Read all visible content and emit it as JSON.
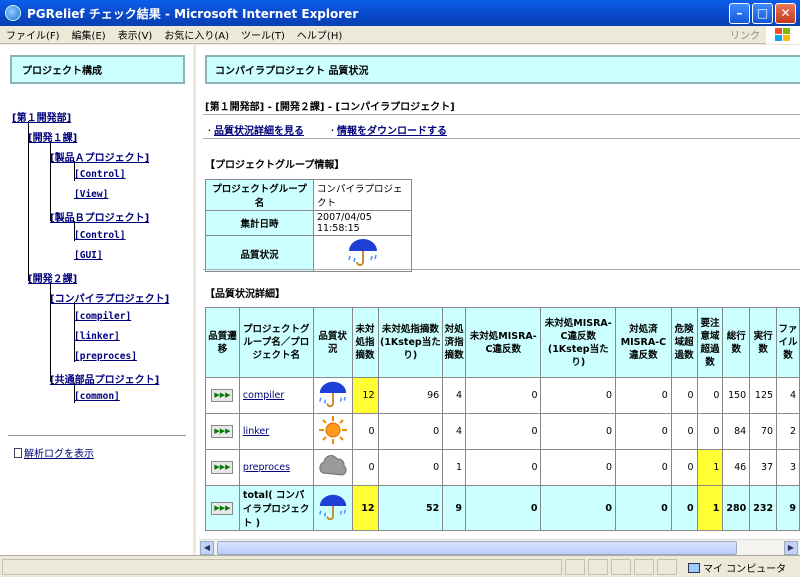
{
  "window": {
    "title": "PGRelief チェック結果 - Microsoft Internet Explorer"
  },
  "menu": {
    "items": [
      "ファイル(F)",
      "編集(E)",
      "表示(V)",
      "お気に入り(A)",
      "ツール(T)",
      "ヘルプ(H)"
    ],
    "link_label": "リンク"
  },
  "left": {
    "header": "プロジェクト構成",
    "tree": [
      {
        "label": "[第１開発部]"
      },
      {
        "label": "[開発１課]"
      },
      {
        "label": "[製品Ａプロジェクト]"
      },
      {
        "label": "[Control]"
      },
      {
        "label": "[View]"
      },
      {
        "label": "[製品Ｂプロジェクト]"
      },
      {
        "label": "[Control]"
      },
      {
        "label": "[GUI]"
      },
      {
        "label": "[開発２課]"
      },
      {
        "label": "[コンパイラプロジェクト]"
      },
      {
        "label": "[compiler]"
      },
      {
        "label": "[linker]"
      },
      {
        "label": "[preproces]"
      },
      {
        "label": "[共通部品プロジェクト]"
      },
      {
        "label": "[common]"
      }
    ],
    "log_link": "解析ログを表示"
  },
  "right": {
    "header": "コンパイラプロジェクト 品質状況",
    "breadcrumb": "[第１開発部] - [開発２課] - [コンパイラプロジェクト]",
    "links": [
      "品質状況詳細を見る",
      "情報をダウンロードする"
    ],
    "group_info_title": "【プロジェクトグループ情報】",
    "group_info": {
      "name_label": "プロジェクトグループ名",
      "name_value": "コンパイラプロジェクト",
      "date_label": "集計日時",
      "date_value": "2007/04/05 11:58:15",
      "quality_label": "品質状況"
    },
    "detail_title": "【品質状況詳細】",
    "columns": [
      "品質遷移",
      "プロジェクトグループ名／プロジェクト名",
      "品質状況",
      "未対処指摘数",
      "未対処指摘数(1Kstep当たり)",
      "対処済指摘数",
      "未対処MISRA-C違反数",
      "未対処MISRA-C違反数(1Kstep当たり)",
      "対処済MISRA-C違反数",
      "危険域超過数",
      "要注意域超過数",
      "総行数",
      "実行数",
      "ファイル数"
    ],
    "rows": [
      {
        "trend": "▶▶▶",
        "name": "compiler",
        "weather": "umbrella",
        "cells": [
          "12",
          "96",
          "4",
          "0",
          "0",
          "0",
          "0",
          "0",
          "150",
          "125",
          "4"
        ]
      },
      {
        "trend": "▶▶▶",
        "name": "linker",
        "weather": "sun",
        "cells": [
          "0",
          "0",
          "4",
          "0",
          "0",
          "0",
          "0",
          "0",
          "84",
          "70",
          "2"
        ]
      },
      {
        "trend": "▶▶▶",
        "name": "preproces",
        "weather": "cloud",
        "cells": [
          "0",
          "0",
          "1",
          "0",
          "0",
          "0",
          "0",
          "1",
          "46",
          "37",
          "3"
        ]
      },
      {
        "trend": "▶▶▶",
        "name": "total( コンパイラプロジェクト )",
        "weather": "umbrella",
        "cells": [
          "12",
          "52",
          "9",
          "0",
          "0",
          "0",
          "0",
          "1",
          "280",
          "232",
          "9"
        ]
      }
    ]
  },
  "status": {
    "zone": "マイ コンピュータ"
  },
  "colors": {
    "accent": "#ccffff",
    "highlight": "#ffff33",
    "title_bar": "#0a5fe8"
  }
}
